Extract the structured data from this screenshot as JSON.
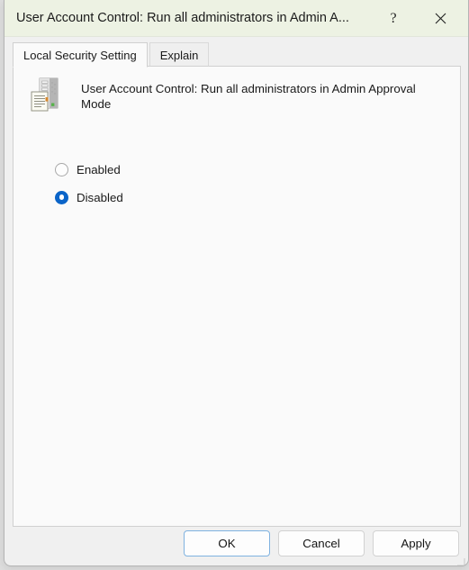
{
  "window": {
    "title": "User Account Control: Run all administrators in Admin A...",
    "help_button_glyph": "?",
    "close_button_glyph": "✕",
    "title_bar_color": "#edf2e3",
    "panel_color": "#fafafa",
    "accent_color": "#0a64c8"
  },
  "tabs": [
    {
      "label": "Local Security Setting",
      "active": true
    },
    {
      "label": "Explain",
      "active": false
    }
  ],
  "policy": {
    "icon_name": "security-policy-computer-icon",
    "title": "User Account Control: Run all administrators in Admin Approval Mode"
  },
  "options": [
    {
      "label": "Enabled",
      "selected": false
    },
    {
      "label": "Disabled",
      "selected": true
    }
  ],
  "footer": {
    "ok_label": "OK",
    "cancel_label": "Cancel",
    "apply_label": "Apply"
  }
}
